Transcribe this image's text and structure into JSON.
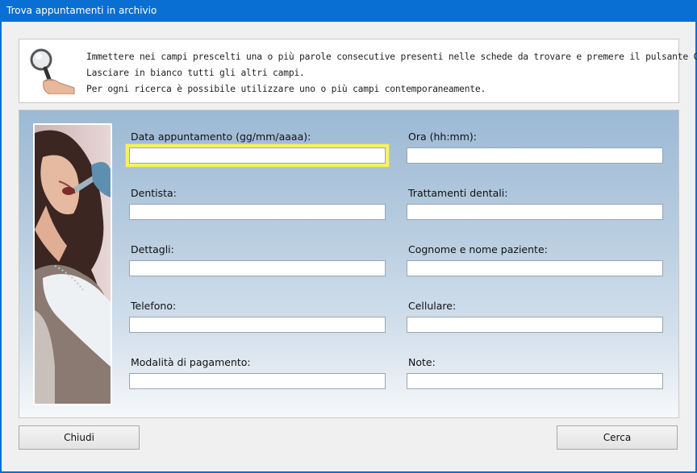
{
  "window": {
    "title": "Trova appuntamenti in archivio"
  },
  "info": {
    "line1": "Immettere nei campi prescelti una o più parole consecutive presenti nelle schede da trovare e premere il pulsante Cerca.",
    "line2": "Lasciare in bianco tutti gli altri campi.",
    "line3": "Per ogni ricerca è possibile utilizzare uno o più campi contemporaneamente."
  },
  "fields": {
    "data_appuntamento": {
      "label": "Data appuntamento (gg/mm/aaaa):",
      "value": ""
    },
    "ora": {
      "label": "Ora (hh:mm):",
      "value": ""
    },
    "dentista": {
      "label": "Dentista:",
      "value": ""
    },
    "trattamenti": {
      "label": "Trattamenti dentali:",
      "value": ""
    },
    "dettagli": {
      "label": "Dettagli:",
      "value": ""
    },
    "paziente": {
      "label": "Cognome e nome paziente:",
      "value": ""
    },
    "telefono": {
      "label": "Telefono:",
      "value": ""
    },
    "cellulare": {
      "label": "Cellulare:",
      "value": ""
    },
    "pagamento": {
      "label": "Modalità di pagamento:",
      "value": ""
    },
    "note": {
      "label": "Note:",
      "value": ""
    }
  },
  "buttons": {
    "chiudi": "Chiudi",
    "cerca": "Cerca"
  },
  "colors": {
    "titlebar": "#0a6fd2",
    "focus_highlight": "#f2f26a"
  },
  "icons": {
    "search": "magnifier-hand-icon"
  }
}
